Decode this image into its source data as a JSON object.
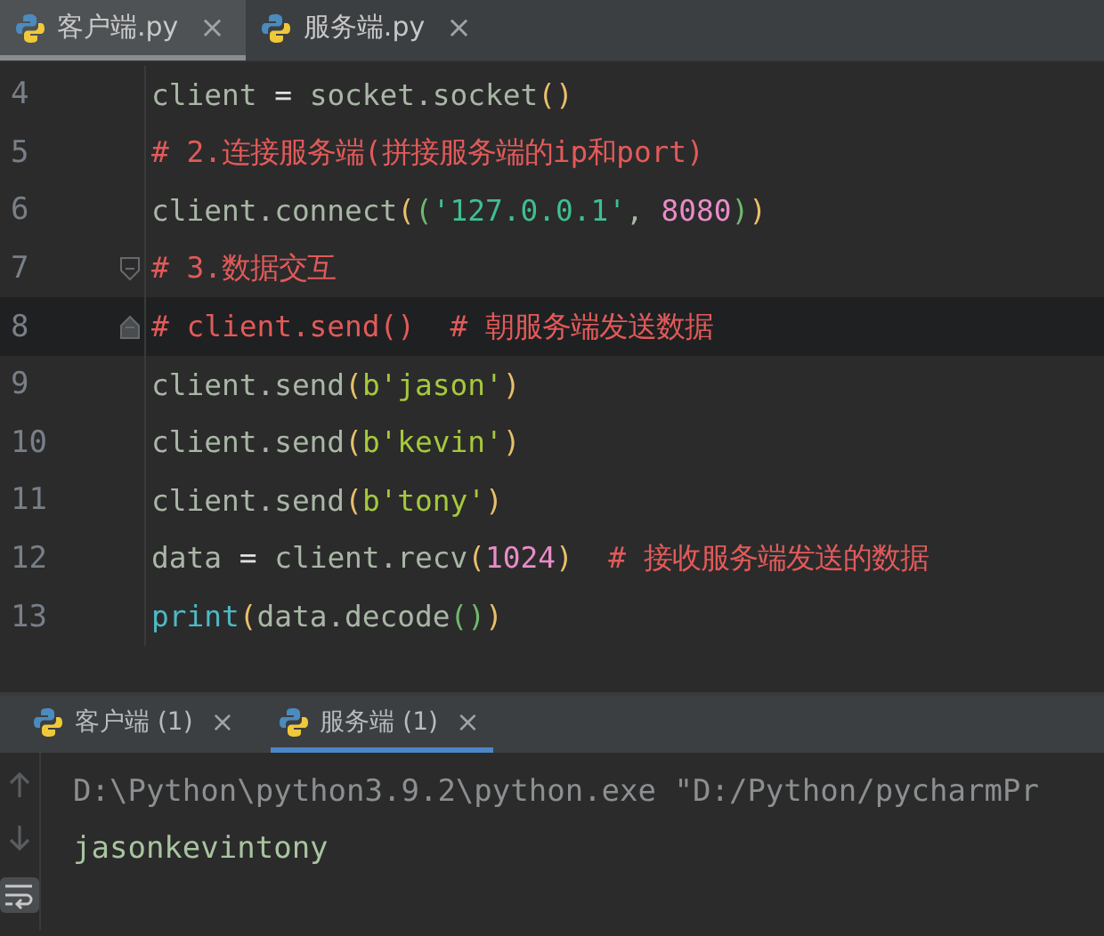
{
  "editor_tabs": [
    {
      "label": "客户端.py",
      "selected": true,
      "close": "×"
    },
    {
      "label": "服务端.py",
      "selected": false,
      "close": "×"
    }
  ],
  "code_lines": [
    {
      "number": "4",
      "current": false,
      "fold": false,
      "tokens": [
        {
          "kind": "text",
          "text": "client "
        },
        {
          "kind": "op",
          "text": "="
        },
        {
          "kind": "text",
          "text": " socket.socket"
        },
        {
          "kind": "paren",
          "text": "()"
        }
      ]
    },
    {
      "number": "5",
      "current": false,
      "fold": false,
      "tokens": [
        {
          "kind": "comment",
          "text": "# 2.连接服务端(拼接服务端的ip和port)"
        }
      ]
    },
    {
      "number": "6",
      "current": false,
      "fold": false,
      "tokens": [
        {
          "kind": "text",
          "text": "client.connect"
        },
        {
          "kind": "paren",
          "text": "("
        },
        {
          "kind": "paren2",
          "text": "("
        },
        {
          "kind": "string",
          "text": "'127.0.0.1'"
        },
        {
          "kind": "text",
          "text": ", "
        },
        {
          "kind": "number",
          "text": "8080"
        },
        {
          "kind": "paren2",
          "text": ")"
        },
        {
          "kind": "paren",
          "text": ")"
        }
      ]
    },
    {
      "number": "7",
      "current": false,
      "fold": true,
      "tokens": [
        {
          "kind": "comment",
          "text": "# 3.数据交互"
        }
      ]
    },
    {
      "number": "8",
      "current": true,
      "fold": true,
      "tokens": [
        {
          "kind": "comment",
          "text": "# client.send()  # 朝服务端发送数据"
        }
      ]
    },
    {
      "number": "9",
      "current": false,
      "fold": false,
      "tokens": [
        {
          "kind": "text",
          "text": "client.send"
        },
        {
          "kind": "paren",
          "text": "("
        },
        {
          "kind": "bytes",
          "text": "b'jason'"
        },
        {
          "kind": "paren",
          "text": ")"
        }
      ]
    },
    {
      "number": "10",
      "current": false,
      "fold": false,
      "tokens": [
        {
          "kind": "text",
          "text": "client.send"
        },
        {
          "kind": "paren",
          "text": "("
        },
        {
          "kind": "bytes",
          "text": "b'kevin'"
        },
        {
          "kind": "paren",
          "text": ")"
        }
      ]
    },
    {
      "number": "11",
      "current": false,
      "fold": false,
      "tokens": [
        {
          "kind": "text",
          "text": "client.send"
        },
        {
          "kind": "paren",
          "text": "("
        },
        {
          "kind": "bytes",
          "text": "b'tony'"
        },
        {
          "kind": "paren",
          "text": ")"
        }
      ]
    },
    {
      "number": "12",
      "current": false,
      "fold": false,
      "tokens": [
        {
          "kind": "text",
          "text": "data "
        },
        {
          "kind": "op",
          "text": "="
        },
        {
          "kind": "text",
          "text": " client.recv"
        },
        {
          "kind": "paren",
          "text": "("
        },
        {
          "kind": "number",
          "text": "1024"
        },
        {
          "kind": "paren",
          "text": ")"
        },
        {
          "kind": "comment",
          "text": "  # 接收服务端发送的数据"
        }
      ]
    },
    {
      "number": "13",
      "current": false,
      "fold": false,
      "tokens": [
        {
          "kind": "builtin",
          "text": "print"
        },
        {
          "kind": "paren",
          "text": "("
        },
        {
          "kind": "text",
          "text": "data.decode"
        },
        {
          "kind": "paren2",
          "text": "()"
        },
        {
          "kind": "paren",
          "text": ")"
        }
      ]
    }
  ],
  "run_tabs": [
    {
      "label": "客户端 (1)",
      "selected": false,
      "close": "×"
    },
    {
      "label": "服务端 (1)",
      "selected": true,
      "close": "×"
    }
  ],
  "console": {
    "lines": [
      {
        "kind": "command",
        "text": "D:\\Python\\python3.9.2\\python.exe \"D:/Python/pycharmPr"
      },
      {
        "kind": "output",
        "text": "jasonkevintony"
      }
    ]
  }
}
